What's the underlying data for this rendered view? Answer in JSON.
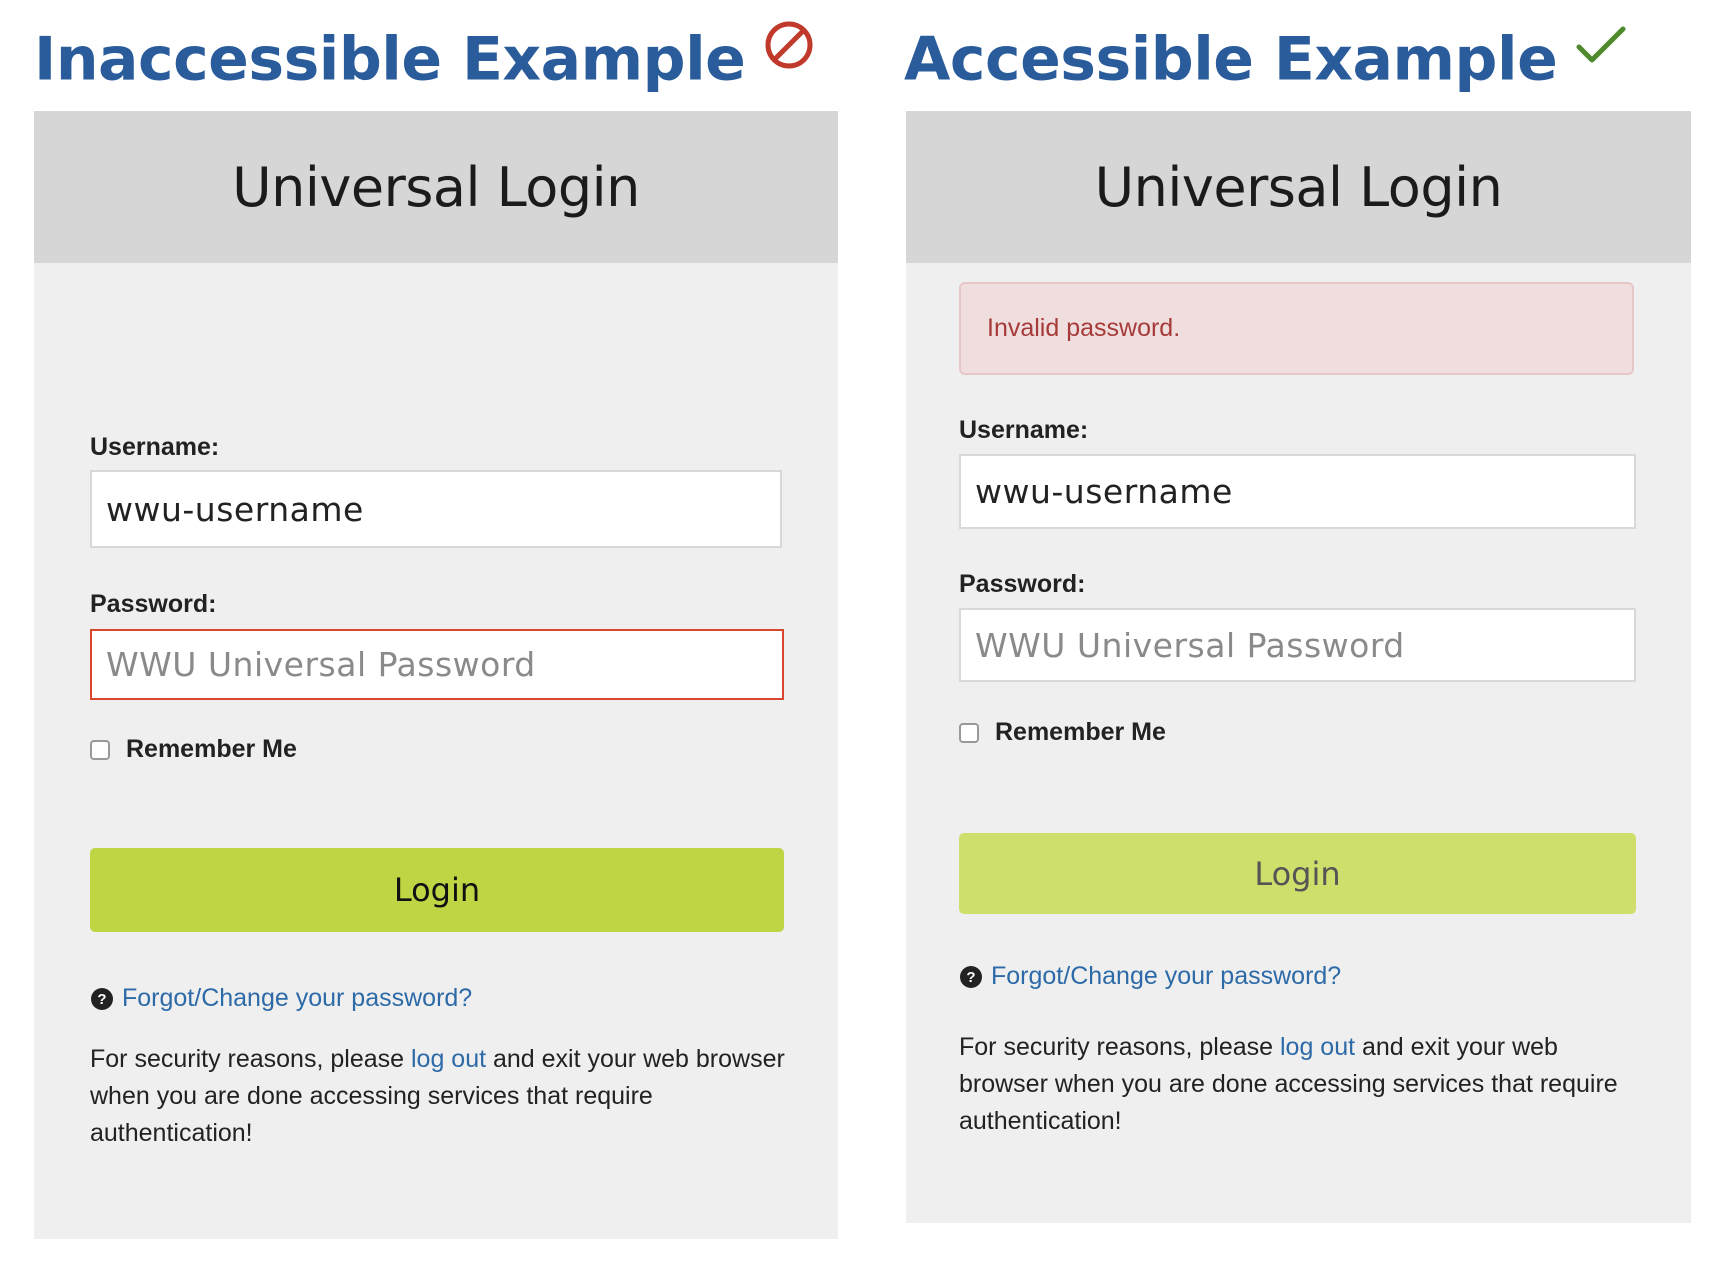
{
  "headings": {
    "inaccessible": "Inaccessible Example",
    "accessible": "Accessible Example"
  },
  "icons": {
    "inaccessible": "prohibited-icon",
    "accessible": "checkmark-icon",
    "help": "question-circle-icon"
  },
  "colors": {
    "heading": "#2a5c9c",
    "prohibited": "#c0392b",
    "checkmark": "#4e8a2e",
    "error_border": "#d9472e",
    "alert_bg": "#f0dede",
    "alert_text": "#a63a39",
    "login_button_left": "#bfd544",
    "login_button_right": "#d0de6b",
    "link": "#2d6aa8"
  },
  "inaccessible": {
    "title": "Universal Login",
    "username_label": "Username:",
    "username_value": "wwu-username",
    "password_label": "Password:",
    "password_placeholder": "WWU Universal Password",
    "remember_label": "Remember Me",
    "remember_checked": false,
    "login_label": "Login",
    "forgot_link": "Forgot/Change your password?",
    "security_prefix": "For security reasons, please ",
    "security_link": "log out",
    "security_suffix": " and exit your web browser when you are done accessing services that require authentication!"
  },
  "accessible": {
    "title": "Universal Login",
    "alert_text": "Invalid password.",
    "username_label": "Username:",
    "username_value": "wwu-username",
    "password_label": "Password:",
    "password_placeholder": "WWU Universal Password",
    "remember_label": "Remember Me",
    "remember_checked": false,
    "login_label": "Login",
    "forgot_link": "Forgot/Change your password?",
    "security_prefix": "For security reasons, please ",
    "security_link": "log out",
    "security_suffix": " and exit your web browser when you are done accessing services that require authentication!"
  }
}
